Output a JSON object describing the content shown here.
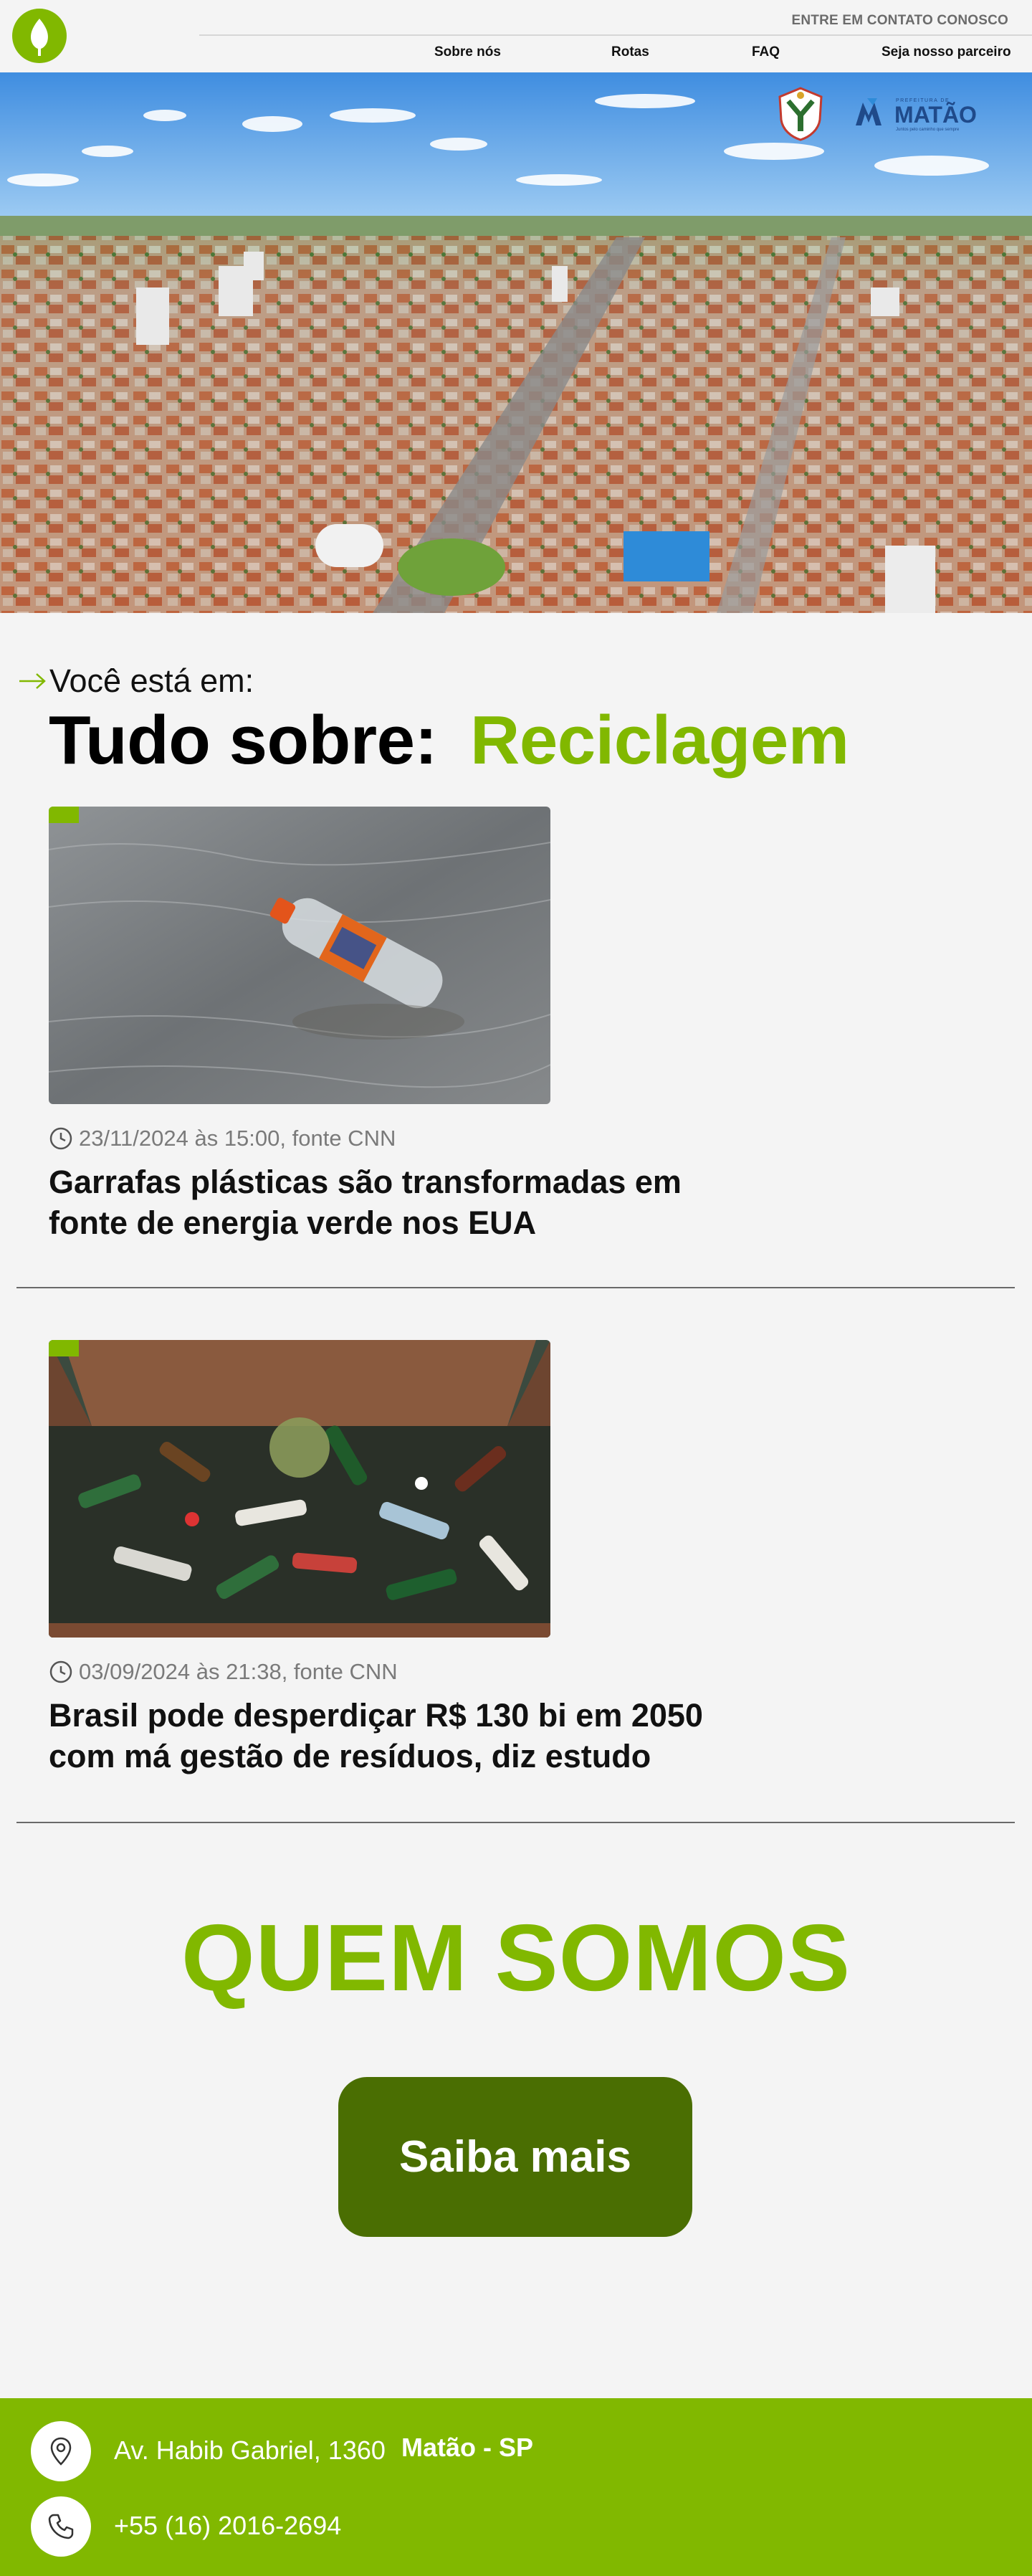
{
  "header": {
    "contact_link": "ENTRE EM CONTATO CONOSCO",
    "nav": [
      "Sobre nós",
      "Rotas",
      "FAQ",
      "Seja nosso parceiro"
    ]
  },
  "hero": {
    "partner_logo_text": "MATÃO",
    "partner_logo_subtext": "PREFEITURA DE",
    "partner_logo_tagline": "Juntos pelo caminho que sempre"
  },
  "breadcrumb": {
    "label": "Você está em:"
  },
  "page_title": {
    "prefix": "Tudo sobre:",
    "topic": "Reciclagem"
  },
  "articles": [
    {
      "meta": "23/11/2024 às 15:00, fonte CNN",
      "title": "Garrafas plásticas são transformadas em fonte de energia verde nos EUA",
      "image": "plastic-bottle-floating-in-water"
    },
    {
      "meta": "03/09/2024 às 21:38, fonte CNN",
      "title": "Brasil pode desperdiçar R$ 130 bi em 2050 com má gestão de resíduos, diz estudo",
      "image": "dumpster-full-of-glass-bottles"
    }
  ],
  "about": {
    "heading": "QUEM SOMOS",
    "button": "Saiba mais"
  },
  "footer": {
    "address": "Av. Habib Gabriel, 1360",
    "city": "Matão - SP",
    "phone": "+55 (16) 2016-2694"
  },
  "colors": {
    "brand_green": "#81b800",
    "dark_green": "#4a6e02",
    "background": "#f4f4f4"
  }
}
